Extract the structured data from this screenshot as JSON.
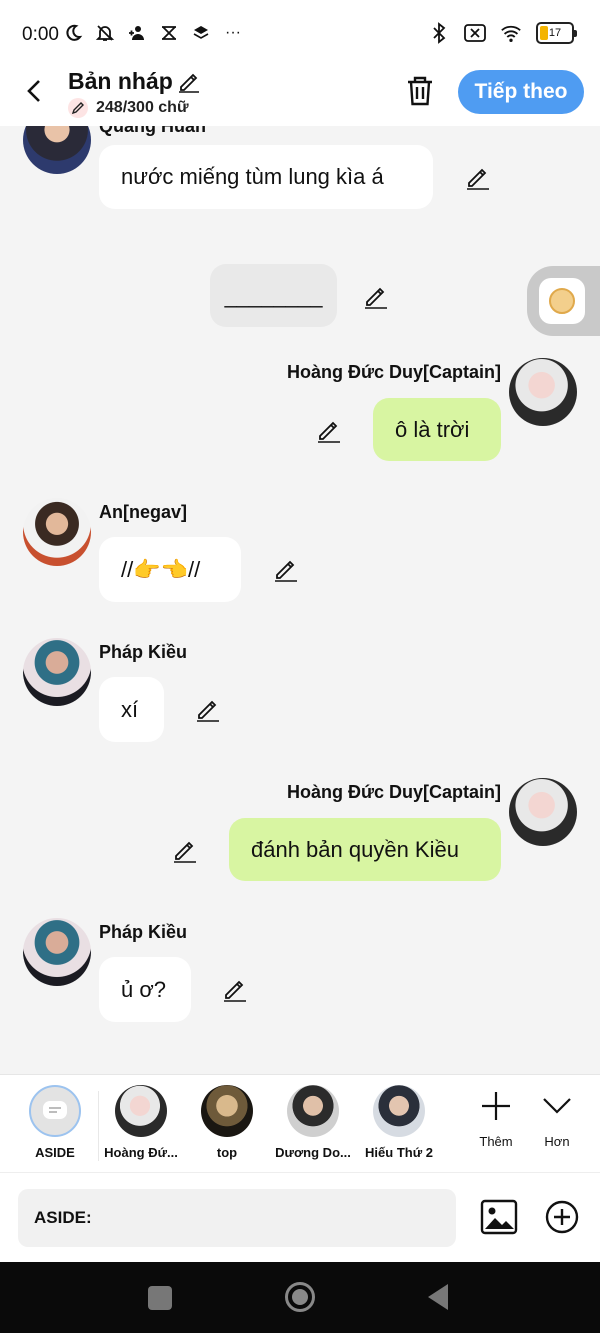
{
  "status_bar": {
    "time": "0:00",
    "dots": "···",
    "battery": "17"
  },
  "header": {
    "title": "Bản nháp",
    "char_count": "248/300 chữ",
    "next_label": "Tiếp theo"
  },
  "messages": [
    {
      "side": "in",
      "name": "Quang Huấn",
      "text": "nước miếng tùm lung kìa á"
    },
    {
      "side": "narration",
      "text": "________"
    },
    {
      "side": "out",
      "name": "Hoàng Đức Duy[Captain]",
      "text": "ô là trời"
    },
    {
      "side": "in",
      "name": "An[negav]",
      "text": "//👉👈//"
    },
    {
      "side": "in",
      "name": "Pháp Kiều",
      "text": "xí"
    },
    {
      "side": "out",
      "name": "Hoàng Đức Duy[Captain]",
      "text": "đánh bản quyền Kiều"
    },
    {
      "side": "in",
      "name": "Pháp Kiều",
      "text": "ủ ơ?"
    }
  ],
  "characters": [
    {
      "name": "ASIDE"
    },
    {
      "name": "Hoàng Đứ..."
    },
    {
      "name": "top"
    },
    {
      "name": "Dương Do..."
    },
    {
      "name": "Hiếu Thứ 2"
    }
  ],
  "bar_actions": {
    "add_label": "Thêm",
    "more_label": "Hơn"
  },
  "input": {
    "placeholder": "ASIDE:"
  },
  "colors": {
    "accent": "#4f9cf2",
    "outgoing_bubble": "#d8f5a2",
    "incoming_bubble": "#ffffff"
  }
}
